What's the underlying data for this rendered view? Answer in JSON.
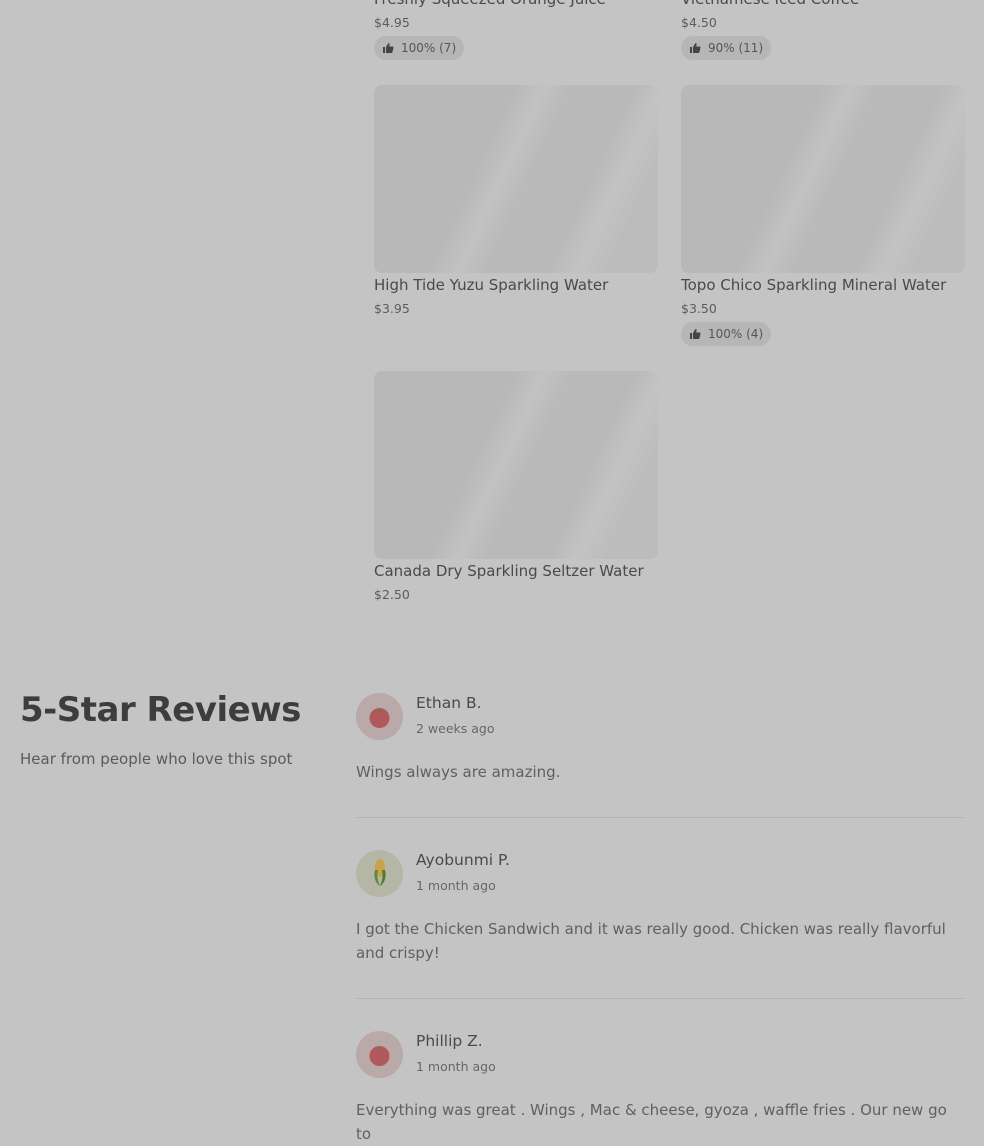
{
  "menu_items": [
    {
      "name": "Freshly Squeezed Orange Juice",
      "price": "$4.95",
      "rating": "100% (7)"
    },
    {
      "name": "Vietnamese Iced Coffee",
      "price": "$4.50",
      "rating": "90% (11)"
    },
    {
      "name": "High Tide Yuzu Sparkling Water",
      "price": "$3.95"
    },
    {
      "name": "Topo Chico Sparkling Mineral Water",
      "price": "$3.50",
      "rating": "100% (4)"
    },
    {
      "name": "Canada Dry Sparkling Seltzer Water",
      "price": "$2.50"
    }
  ],
  "reviews_section": {
    "title": "5-Star Reviews",
    "subtitle": "Hear from people who love this spot",
    "reviews": [
      {
        "name": "Ethan B.",
        "time": "2 weeks ago",
        "avatar_icon": "tomato-icon",
        "text": "Wings always are amazing."
      },
      {
        "name": "Ayobunmi P.",
        "time": "1 month ago",
        "avatar_icon": "corn-icon",
        "text": "I got the Chicken Sandwich and it was really good. Chicken was really flavorful and crispy!"
      },
      {
        "name": "Phillip Z.",
        "time": "1 month ago",
        "avatar_icon": "tomato-icon",
        "text": "Everything was great . Wings , Mac & cheese, gyoza , waffle fries . Our new go to"
      }
    ]
  }
}
